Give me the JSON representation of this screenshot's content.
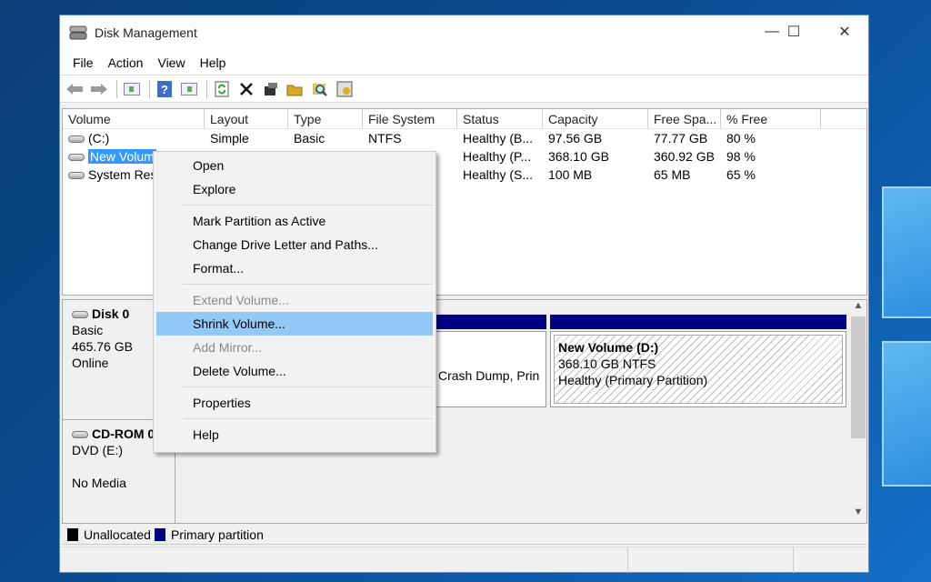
{
  "window": {
    "title": "Disk Management",
    "controls": {
      "minimize": "—",
      "maximize": "☐",
      "close": "✕"
    }
  },
  "menu": [
    "File",
    "Action",
    "View",
    "Help"
  ],
  "toolbar": [
    "back-icon",
    "forward-icon",
    "console-tree-icon",
    "help-icon",
    "action-pane-icon",
    "refresh-icon",
    "delete-icon",
    "properties-icon",
    "open-icon",
    "explore-icon",
    "settings-icon"
  ],
  "table": {
    "headers": [
      "Volume",
      "Layout",
      "Type",
      "File System",
      "Status",
      "Capacity",
      "Free Spa...",
      "% Free"
    ],
    "rows": [
      [
        "(C:)",
        "Simple",
        "Basic",
        "NTFS",
        "Healthy (B...",
        "97.56 GB",
        "77.77 GB",
        "80 %"
      ],
      [
        "New Volum",
        "",
        "",
        "",
        "Healthy (P...",
        "368.10 GB",
        "360.92 GB",
        "98 %"
      ],
      [
        "System Rese",
        "",
        "",
        "",
        "Healthy (S...",
        "100 MB",
        "65 MB",
        "65 %"
      ]
    ]
  },
  "context_menu": {
    "items": [
      {
        "label": "Open",
        "enabled": true
      },
      {
        "label": "Explore",
        "enabled": true
      },
      {
        "sep": true
      },
      {
        "label": "Mark Partition as Active",
        "enabled": true
      },
      {
        "label": "Change Drive Letter and Paths...",
        "enabled": true
      },
      {
        "label": "Format...",
        "enabled": true
      },
      {
        "sep": true
      },
      {
        "label": "Extend Volume...",
        "enabled": false
      },
      {
        "label": "Shrink Volume...",
        "enabled": true,
        "highlighted": true
      },
      {
        "label": "Add Mirror...",
        "enabled": false
      },
      {
        "label": "Delete Volume...",
        "enabled": true
      },
      {
        "sep": true
      },
      {
        "label": "Properties",
        "enabled": true
      },
      {
        "sep": true
      },
      {
        "label": "Help",
        "enabled": true
      }
    ]
  },
  "disks": [
    {
      "name": "Disk 0",
      "type": "Basic",
      "size": "465.76 GB",
      "status": "Online"
    },
    {
      "name": "CD-ROM 0",
      "type": "DVD (E:)",
      "size": "",
      "status": "No Media"
    }
  ],
  "partitions": {
    "c_fragment": "Crash Dump, Prin",
    "d": {
      "name": "New Volume  (D:)",
      "size": "368.10 GB NTFS",
      "status": "Healthy (Primary Partition)"
    }
  },
  "legend": [
    {
      "label": "Unallocated",
      "color": "#000000"
    },
    {
      "label": "Primary partition",
      "color": "#000080"
    }
  ],
  "colors": {
    "primary": "#000080",
    "selection": "#3399ff",
    "menu_highlight": "#91c9f7"
  }
}
